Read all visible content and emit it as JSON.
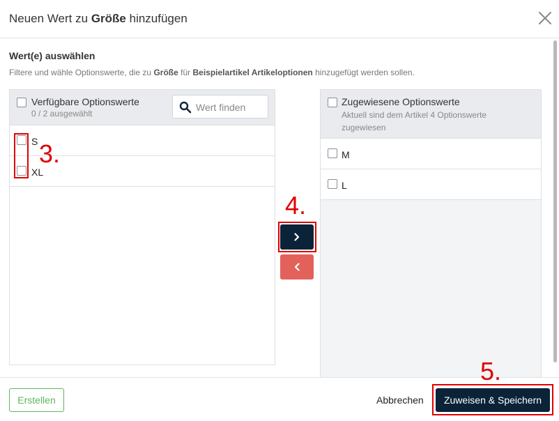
{
  "dialog": {
    "title_prefix": "Neuen Wert zu",
    "title_bold": "Größe",
    "title_suffix": "hinzufügen",
    "close_icon": "close-icon"
  },
  "section": {
    "title": "Wert(e) auswählen",
    "desc_1": "Filtere und wähle Optionswerte, die zu",
    "desc_bold_1": "Größe",
    "desc_2": "für",
    "desc_bold_2": "Beispielartikel Artikeloptionen",
    "desc_3": "hinzugefügt werden sollen."
  },
  "available": {
    "title": "Verfügbare Optionswerte",
    "subtitle": "0 / 2 ausgewählt",
    "search_placeholder": "Wert finden",
    "items": [
      {
        "label": "S",
        "checked": false
      },
      {
        "label": "XL",
        "checked": false
      }
    ]
  },
  "assigned": {
    "title": "Zugewiesene Optionswerte",
    "subtitle": "Aktuell sind dem Artikel 4 Optionswerte zugewiesen",
    "items": [
      {
        "label": "M",
        "checked": false
      },
      {
        "label": "L",
        "checked": false
      }
    ]
  },
  "move_buttons": {
    "right_icon": "chevron-right-icon",
    "left_icon": "chevron-left-icon",
    "right_color": "#0b2338",
    "left_color": "#e2615a"
  },
  "annotations": {
    "step_3": "3.",
    "step_4": "4.",
    "step_5": "5.",
    "color": "#e00000"
  },
  "footer": {
    "create_label": "Erstellen",
    "cancel_label": "Abbrechen",
    "save_label": "Zuweisen & Speichern"
  },
  "colors": {
    "primary": "#0b2338",
    "success": "#5cb85c",
    "danger": "#e2615a"
  }
}
